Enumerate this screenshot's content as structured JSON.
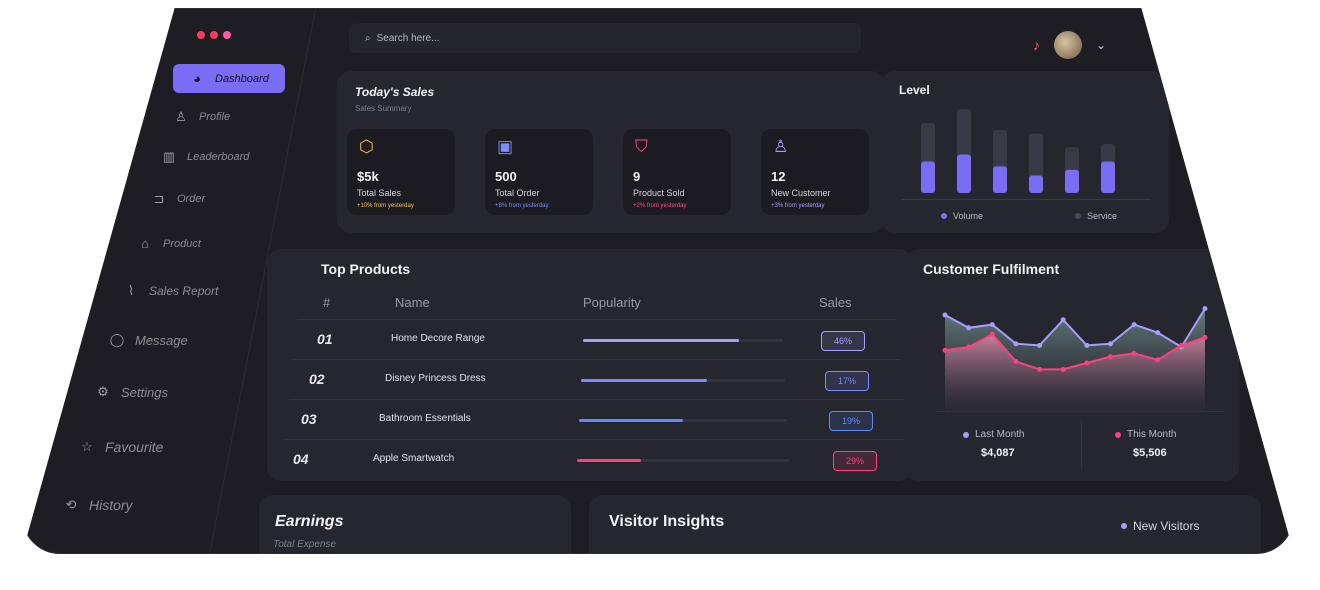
{
  "colors": {
    "accent": "#7b6cf6",
    "pink": "#ff3f7f",
    "yellow": "#f6c344",
    "blue": "#5b8cff",
    "teal": "#4ed8c0"
  },
  "sidebar": {
    "items": [
      {
        "label": "Dashboard",
        "icon": "dashboard-icon",
        "glyph": "◕"
      },
      {
        "label": "Profile",
        "icon": "profile-icon",
        "glyph": "♙"
      },
      {
        "label": "Leaderboard",
        "icon": "leaderboard-icon",
        "glyph": "▥"
      },
      {
        "label": "Order",
        "icon": "cart-icon",
        "glyph": "⊐"
      },
      {
        "label": "Product",
        "icon": "bag-icon",
        "glyph": "⌂"
      },
      {
        "label": "Sales Report",
        "icon": "chart-line-icon",
        "glyph": "⌇"
      },
      {
        "label": "Message",
        "icon": "message-icon",
        "glyph": "◯"
      },
      {
        "label": "Settings",
        "icon": "settings-icon",
        "glyph": "⚙"
      },
      {
        "label": "Favourite",
        "icon": "star-icon",
        "glyph": "☆"
      },
      {
        "label": "History",
        "icon": "history-icon",
        "glyph": "⟲"
      }
    ]
  },
  "search": {
    "placeholder": "Search here..."
  },
  "sales": {
    "title": "Today's Sales",
    "subtitle": "Sales Summary",
    "stats": [
      {
        "value": "$5k",
        "label": "Total Sales",
        "change": "+10% from yesterday",
        "icon": "sales-icon",
        "glyph": "⬡",
        "color": "#f6c344"
      },
      {
        "value": "500",
        "label": "Total Order",
        "change": "+8% from yesterday",
        "icon": "order-icon",
        "glyph": "▣",
        "color": "#7b8cff"
      },
      {
        "value": "9",
        "label": "Product Sold",
        "change": "+2% from yesterday",
        "icon": "product-icon",
        "glyph": "⛉",
        "color": "#ff4f7f"
      },
      {
        "value": "12",
        "label": "New Customer",
        "change": "+3% from yesterday",
        "icon": "customer-icon",
        "glyph": "♙",
        "color": "#a99cff"
      }
    ]
  },
  "level": {
    "title": "Level",
    "legend": [
      "Volume",
      "Service"
    ],
    "chart_data": {
      "type": "bar",
      "series": [
        {
          "name": "Volume",
          "values": [
            0.45,
            0.55,
            0.38,
            0.25,
            0.33,
            0.45
          ]
        },
        {
          "name": "Service",
          "values": [
            1.0,
            1.2,
            0.9,
            0.85,
            0.65,
            0.7
          ]
        }
      ]
    }
  },
  "products": {
    "title": "Top Products",
    "headers": [
      "#",
      "Name",
      "Popularity",
      "Sales"
    ],
    "rows": [
      {
        "num": "01",
        "name": "Home Decore Range",
        "popularity": 0.78,
        "sales": "46%",
        "color": "#a99cff"
      },
      {
        "num": "02",
        "name": "Disney Princess Dress",
        "popularity": 0.62,
        "sales": "17%",
        "color": "#7b8cff"
      },
      {
        "num": "03",
        "name": "Bathroom Essentials",
        "popularity": 0.5,
        "sales": "19%",
        "color": "#5b8cff"
      },
      {
        "num": "04",
        "name": "Apple Smartwatch",
        "popularity": 0.3,
        "sales": "29%",
        "color": "#ff3f7f"
      }
    ]
  },
  "fulfilment": {
    "title": "Customer Fulfilment",
    "legend": [
      {
        "label": "Last Month",
        "value": "$4,087",
        "color": "#a99cff"
      },
      {
        "label": "This Month",
        "value": "$5,506",
        "color": "#ff3f7f"
      }
    ],
    "chart_data": {
      "type": "area",
      "series": [
        {
          "name": "Last Month",
          "values": [
            5.0,
            4.2,
            4.4,
            3.2,
            3.1,
            4.7,
            3.1,
            3.2,
            4.4,
            3.9,
            3.0,
            5.4
          ]
        },
        {
          "name": "This Month",
          "values": [
            2.8,
            3.0,
            3.8,
            2.1,
            1.6,
            1.6,
            2.0,
            2.4,
            2.6,
            2.2,
            3.1,
            3.6
          ]
        }
      ]
    }
  },
  "earnings": {
    "title": "Earnings",
    "subtitle": "Total Expense"
  },
  "visitors": {
    "title": "Visitor Insights",
    "legend": "New Visitors"
  }
}
